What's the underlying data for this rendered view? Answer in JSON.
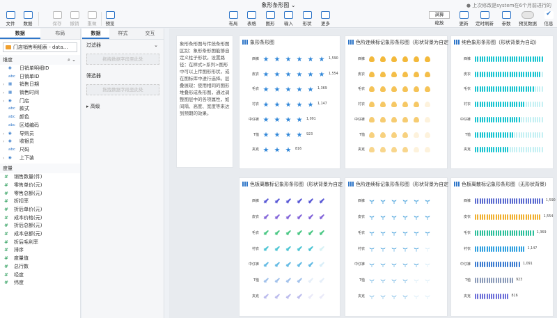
{
  "title": "象形条形图",
  "save_info": "上次修改是system在6个月前进行的",
  "toolbar_left": [
    {
      "label": "文件",
      "icon": "menu-icon",
      "dis": false
    },
    {
      "label": "数据",
      "icon": "database-icon",
      "dis": false
    },
    {
      "label": "保存",
      "icon": "save-icon",
      "dis": true
    },
    {
      "label": "撤销",
      "icon": "undo-icon",
      "dis": true
    },
    {
      "label": "重做",
      "icon": "redo-icon",
      "dis": true
    },
    {
      "label": "预览",
      "icon": "preview-icon",
      "dis": false
    }
  ],
  "toolbar_mid": [
    {
      "label": "布局",
      "icon": "layout-icon"
    },
    {
      "label": "表格",
      "icon": "table-icon"
    },
    {
      "label": "图形",
      "icon": "chart-icon"
    },
    {
      "label": "输入",
      "icon": "input-icon"
    },
    {
      "label": "形状",
      "icon": "shape-icon"
    },
    {
      "label": "更多",
      "icon": "more-icon"
    }
  ],
  "toolbar_right": {
    "zoom_select": "满算",
    "zoom_label": "缩放",
    "refresh": "更新",
    "timer": "定时刷新",
    "params": "参数",
    "preview_data": "预览数据",
    "info": "信息"
  },
  "left_panel": {
    "tabs": [
      "数据",
      "布局"
    ],
    "datasource": "门店销售明细表 - data...",
    "dim_title": "维度",
    "dimensions": [
      {
        "t": "geo",
        "n": "日销单明细ID",
        "c": false
      },
      {
        "t": "abc",
        "n": "日销单ID",
        "c": false
      },
      {
        "t": "date",
        "n": "销售日期",
        "c": true
      },
      {
        "t": "date",
        "n": "销售时间",
        "c": true
      },
      {
        "t": "geo",
        "n": "门店",
        "c": true
      },
      {
        "t": "abc",
        "n": "款式",
        "c": false
      },
      {
        "t": "abc",
        "n": "颜色",
        "c": false
      },
      {
        "t": "abc",
        "n": "区域编码",
        "c": false
      },
      {
        "t": "geo",
        "n": "导购员",
        "c": true
      },
      {
        "t": "geo",
        "n": "收银员",
        "c": true
      },
      {
        "t": "abc",
        "n": "尺码",
        "c": false
      },
      {
        "t": "geo",
        "n": "上下装",
        "c": true
      }
    ],
    "mea_title": "度量",
    "measures": [
      "销售数量(件)",
      "零售单价(元)",
      "零售总额(元)",
      "折扣率",
      "折后单价(元)",
      "成本价格(元)",
      "折后总额(元)",
      "成本总额(元)",
      "折后毛利率",
      "排序",
      "度量值",
      "总行数",
      "经度",
      "纬度"
    ]
  },
  "mid_panel": {
    "tabs": [
      "数据",
      "样式",
      "交互"
    ],
    "filter_label": "过滤器",
    "filter_hint": "拖拽数据字段至此处",
    "screen_label": "筛选器",
    "screen_hint": "拖拽数据字段至此处",
    "advanced": "高级"
  },
  "description": "象形条形图与传统条形图区别：象形条形图能够自定义柱子形状。设置路径：在样式>系列>图形中可以上传图形形状，或在图标库中进行选择。层叠展现：使用相同的图形堆叠形成条形图，通过调整图层中的各项属性，如间隔、高度、宽度等来达到预期的效果。",
  "categories": [
    "西裤",
    "皮衣",
    "毛衣",
    "衬衣",
    "中仔裤",
    "T恤",
    "夹克"
  ],
  "values": [
    1590,
    1554,
    1369,
    1147,
    1091,
    923,
    816
  ],
  "value_labels": [
    "1,590",
    "1,554",
    "1,369",
    "1,147",
    "1,091",
    "923",
    "816"
  ],
  "charts": [
    {
      "title": "象形条形图",
      "sym": "st",
      "color": "#2f86d8",
      "mode": "stars",
      "show_vals": true
    },
    {
      "title": "色阶连续标记象形条形图（形状背景为自定",
      "sym": "cl",
      "color": "#f3b93b",
      "mode": "fill",
      "show_vals": false
    },
    {
      "title": "纯色象形条形图（形状背景为自动）",
      "sym": "bk",
      "color": "#17c4d0",
      "mode": "bars",
      "show_vals": false
    },
    {
      "title": "色板离散标记象形条形图（形状背景为自定",
      "sym": "rk",
      "color": "#5b5bd6",
      "mode": "fill2",
      "show_vals": false
    },
    {
      "title": "色阶连续标记象形条形图（形状背景为自定",
      "sym": "pl",
      "color": "#3a9ad9",
      "mode": "fill3",
      "show_vals": false
    },
    {
      "title": "色板离散标记象形条形图（无形状背景）",
      "sym": "bk",
      "color": "#6a72d6",
      "mode": "bars2",
      "show_vals": true
    }
  ]
}
